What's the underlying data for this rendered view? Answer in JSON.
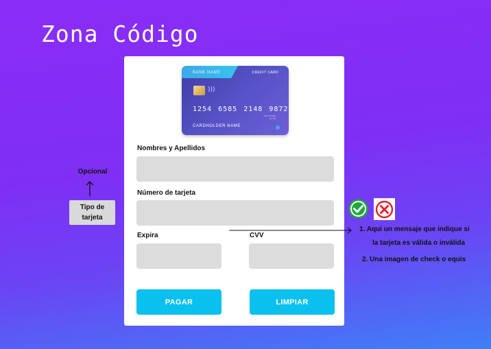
{
  "brand": {
    "title": "Zona Código"
  },
  "credit_card": {
    "bank_name": "BANK NAME",
    "card_type": "CREDIT CARD",
    "number": "1254 6585 2148 9872",
    "valid_label": "VALID THRU",
    "valid_date": "05 / 25",
    "holder": "CARDHOLDER NAME"
  },
  "form": {
    "name_label": "Nombres y Apellidos",
    "name_value": "",
    "card_number_label": "Número de tarjeta",
    "card_number_value": "",
    "expiry_label": "Expira",
    "expiry_value": "",
    "cvv_label": "CVV",
    "cvv_value": ""
  },
  "buttons": {
    "pay_label": "PAGAR",
    "clear_label": "LIMPIAR"
  },
  "annotations": {
    "optional_label": "Opcional",
    "card_type_line1": "Tipo de",
    "card_type_line2": "tarjeta",
    "note1_line1": "1. Aquí un mensaje que indique si",
    "note1_line2": "la tarjeta es válida o inválida",
    "note2": "2. Una imagen de check o equis"
  },
  "icons": {
    "valid": "check-circle-icon",
    "invalid": "cross-circle-icon",
    "contactless": "contactless-icon"
  },
  "colors": {
    "accent_button": "#09c0ee",
    "valid_green": "#1fa83a",
    "invalid_red": "#e8202a",
    "input_bg": "#dcdcdc"
  }
}
